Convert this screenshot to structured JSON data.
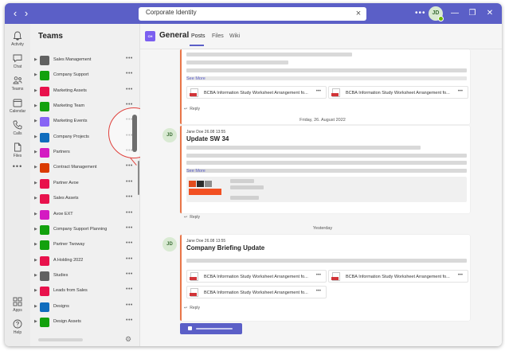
{
  "titlebar": {
    "search_value": "Corporate Identity",
    "user_initials": "JD"
  },
  "rail": {
    "items": [
      {
        "label": "Activity",
        "icon": "bell-icon"
      },
      {
        "label": "Chat",
        "icon": "chat-icon"
      },
      {
        "label": "Teams",
        "icon": "teams-icon"
      },
      {
        "label": "Calendar",
        "icon": "calendar-icon"
      },
      {
        "label": "Calls",
        "icon": "phone-icon"
      },
      {
        "label": "Files",
        "icon": "file-icon"
      }
    ],
    "bottom_items": [
      {
        "label": "Apps",
        "icon": "apps-icon"
      },
      {
        "label": "Help",
        "icon": "help-icon"
      }
    ]
  },
  "teams_panel": {
    "title": "Teams",
    "teams": [
      {
        "name": "Sales Management",
        "color": "#616161"
      },
      {
        "name": "Company Support",
        "color": "#13a10e"
      },
      {
        "name": "Marketing Assets",
        "color": "#e8124c"
      },
      {
        "name": "Marketing Team",
        "color": "#13a10e"
      },
      {
        "name": "Marketing Events",
        "color": "#8764f5"
      },
      {
        "name": "Company Projects",
        "color": "#0f6cbd"
      },
      {
        "name": "Partners",
        "color": "#d41ac2"
      },
      {
        "name": "Contract Management",
        "color": "#da3b01"
      },
      {
        "name": "Partner Avoe",
        "color": "#e8124c"
      },
      {
        "name": "Sales Assets",
        "color": "#e8124c"
      },
      {
        "name": "Avoe EXT",
        "color": "#d41ac2"
      },
      {
        "name": "Company Support Planning",
        "color": "#13a10e"
      },
      {
        "name": "Partner Twoway",
        "color": "#13a10e"
      },
      {
        "name": "A Holding 2022",
        "color": "#e8124c"
      },
      {
        "name": "Studies",
        "color": "#616161"
      },
      {
        "name": "Leads from Sales",
        "color": "#e8124c"
      },
      {
        "name": "Designs",
        "color": "#0f6cbd"
      },
      {
        "name": "Design Assets",
        "color": "#13a10e"
      }
    ]
  },
  "channel": {
    "tile_text": "CH",
    "name": "General",
    "tabs": [
      "Posts",
      "Files",
      "Wiki"
    ]
  },
  "feed": {
    "post1": {
      "see_more": "See More",
      "attachments": [
        "BCBA Information Study Worksheet Arrangement fo...",
        "BCBA Information Study Worksheet Arrangement fo..."
      ],
      "reply": "Reply"
    },
    "date1": "Friday, 26. August 2022",
    "post2": {
      "initials": "JD",
      "author": "Jane Doe   26.08 13:55",
      "title": "Update SW 34",
      "see_more": "See More",
      "reply": "Reply"
    },
    "date2": "Yesterday",
    "post3": {
      "initials": "JD",
      "author": "Jane Doe   26.08 13:55",
      "title": "Company Briefing Update",
      "attachments": [
        "BCBA Information Study Worksheet Arrangement fo...",
        "BCBA Information Study Worksheet Arrangement fo...",
        "BCBA Information Study Worksheet Arrangement fo..."
      ],
      "reply": "Reply"
    }
  },
  "colors": {
    "accent": "#5b5fc7",
    "post_accent": "#e97548",
    "presence": "#6bb700"
  }
}
